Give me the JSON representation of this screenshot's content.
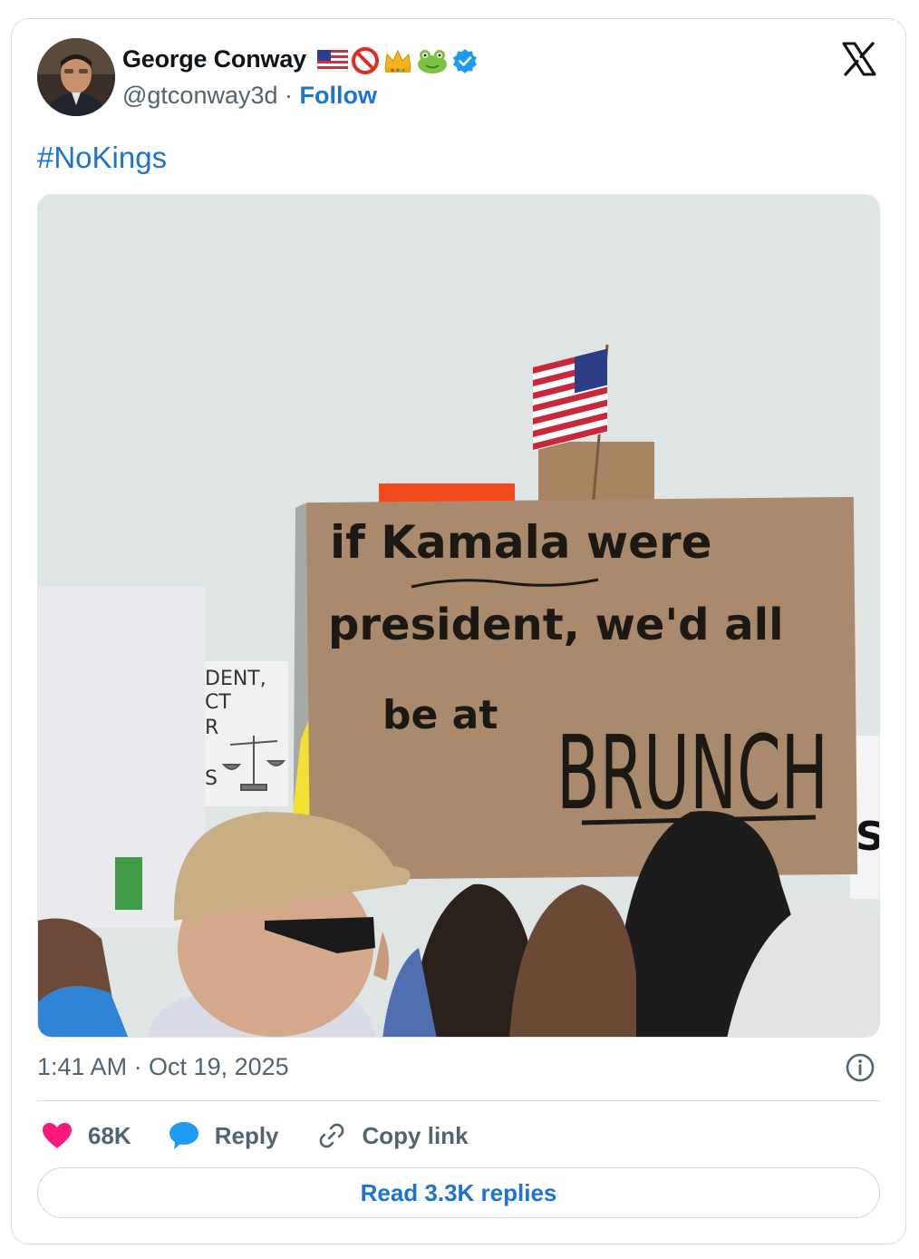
{
  "author": {
    "name": "George Conway",
    "handle": "@gtconway3d",
    "separator": "·",
    "follow_label": "Follow",
    "name_emojis": [
      "us-flag-icon",
      "no-entry-icon",
      "crown-icon",
      "frog-icon"
    ],
    "verified": true
  },
  "tweet": {
    "text": "#NoKings",
    "photo": {
      "sign_lines": [
        "if Kamala were",
        "president, we'd all",
        "be at",
        "BRUNCH"
      ],
      "side_sign_lines": [
        "DENT,",
        "CT",
        "R",
        "S"
      ],
      "right_sign_letter": "S"
    },
    "timestamp": "1:41 AM · Oct 19, 2025"
  },
  "actions": {
    "likes": "68K",
    "reply_label": "Reply",
    "copy_link_label": "Copy link"
  },
  "read_replies_label": "Read 3.3K replies",
  "colors": {
    "link_blue": "#1d73d2",
    "muted": "#536471",
    "like_pink": "#f91880",
    "verified_blue": "#1d9bf0"
  }
}
